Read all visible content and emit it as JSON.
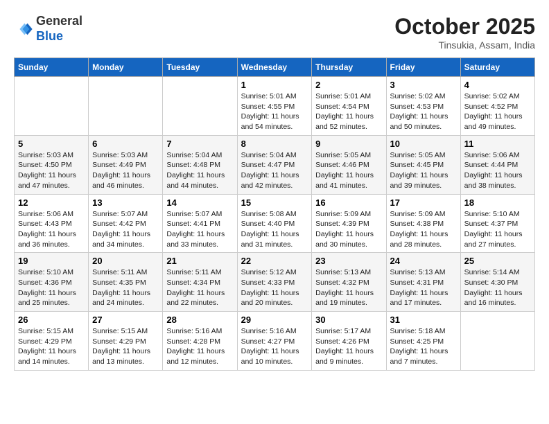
{
  "header": {
    "logo": {
      "line1": "General",
      "line2": "Blue"
    },
    "month": "October 2025",
    "location": "Tinsukia, Assam, India"
  },
  "weekdays": [
    "Sunday",
    "Monday",
    "Tuesday",
    "Wednesday",
    "Thursday",
    "Friday",
    "Saturday"
  ],
  "weeks": [
    [
      {
        "day": "",
        "sunrise": "",
        "sunset": "",
        "daylight": ""
      },
      {
        "day": "",
        "sunrise": "",
        "sunset": "",
        "daylight": ""
      },
      {
        "day": "",
        "sunrise": "",
        "sunset": "",
        "daylight": ""
      },
      {
        "day": "1",
        "sunrise": "Sunrise: 5:01 AM",
        "sunset": "Sunset: 4:55 PM",
        "daylight": "Daylight: 11 hours and 54 minutes."
      },
      {
        "day": "2",
        "sunrise": "Sunrise: 5:01 AM",
        "sunset": "Sunset: 4:54 PM",
        "daylight": "Daylight: 11 hours and 52 minutes."
      },
      {
        "day": "3",
        "sunrise": "Sunrise: 5:02 AM",
        "sunset": "Sunset: 4:53 PM",
        "daylight": "Daylight: 11 hours and 50 minutes."
      },
      {
        "day": "4",
        "sunrise": "Sunrise: 5:02 AM",
        "sunset": "Sunset: 4:52 PM",
        "daylight": "Daylight: 11 hours and 49 minutes."
      }
    ],
    [
      {
        "day": "5",
        "sunrise": "Sunrise: 5:03 AM",
        "sunset": "Sunset: 4:50 PM",
        "daylight": "Daylight: 11 hours and 47 minutes."
      },
      {
        "day": "6",
        "sunrise": "Sunrise: 5:03 AM",
        "sunset": "Sunset: 4:49 PM",
        "daylight": "Daylight: 11 hours and 46 minutes."
      },
      {
        "day": "7",
        "sunrise": "Sunrise: 5:04 AM",
        "sunset": "Sunset: 4:48 PM",
        "daylight": "Daylight: 11 hours and 44 minutes."
      },
      {
        "day": "8",
        "sunrise": "Sunrise: 5:04 AM",
        "sunset": "Sunset: 4:47 PM",
        "daylight": "Daylight: 11 hours and 42 minutes."
      },
      {
        "day": "9",
        "sunrise": "Sunrise: 5:05 AM",
        "sunset": "Sunset: 4:46 PM",
        "daylight": "Daylight: 11 hours and 41 minutes."
      },
      {
        "day": "10",
        "sunrise": "Sunrise: 5:05 AM",
        "sunset": "Sunset: 4:45 PM",
        "daylight": "Daylight: 11 hours and 39 minutes."
      },
      {
        "day": "11",
        "sunrise": "Sunrise: 5:06 AM",
        "sunset": "Sunset: 4:44 PM",
        "daylight": "Daylight: 11 hours and 38 minutes."
      }
    ],
    [
      {
        "day": "12",
        "sunrise": "Sunrise: 5:06 AM",
        "sunset": "Sunset: 4:43 PM",
        "daylight": "Daylight: 11 hours and 36 minutes."
      },
      {
        "day": "13",
        "sunrise": "Sunrise: 5:07 AM",
        "sunset": "Sunset: 4:42 PM",
        "daylight": "Daylight: 11 hours and 34 minutes."
      },
      {
        "day": "14",
        "sunrise": "Sunrise: 5:07 AM",
        "sunset": "Sunset: 4:41 PM",
        "daylight": "Daylight: 11 hours and 33 minutes."
      },
      {
        "day": "15",
        "sunrise": "Sunrise: 5:08 AM",
        "sunset": "Sunset: 4:40 PM",
        "daylight": "Daylight: 11 hours and 31 minutes."
      },
      {
        "day": "16",
        "sunrise": "Sunrise: 5:09 AM",
        "sunset": "Sunset: 4:39 PM",
        "daylight": "Daylight: 11 hours and 30 minutes."
      },
      {
        "day": "17",
        "sunrise": "Sunrise: 5:09 AM",
        "sunset": "Sunset: 4:38 PM",
        "daylight": "Daylight: 11 hours and 28 minutes."
      },
      {
        "day": "18",
        "sunrise": "Sunrise: 5:10 AM",
        "sunset": "Sunset: 4:37 PM",
        "daylight": "Daylight: 11 hours and 27 minutes."
      }
    ],
    [
      {
        "day": "19",
        "sunrise": "Sunrise: 5:10 AM",
        "sunset": "Sunset: 4:36 PM",
        "daylight": "Daylight: 11 hours and 25 minutes."
      },
      {
        "day": "20",
        "sunrise": "Sunrise: 5:11 AM",
        "sunset": "Sunset: 4:35 PM",
        "daylight": "Daylight: 11 hours and 24 minutes."
      },
      {
        "day": "21",
        "sunrise": "Sunrise: 5:11 AM",
        "sunset": "Sunset: 4:34 PM",
        "daylight": "Daylight: 11 hours and 22 minutes."
      },
      {
        "day": "22",
        "sunrise": "Sunrise: 5:12 AM",
        "sunset": "Sunset: 4:33 PM",
        "daylight": "Daylight: 11 hours and 20 minutes."
      },
      {
        "day": "23",
        "sunrise": "Sunrise: 5:13 AM",
        "sunset": "Sunset: 4:32 PM",
        "daylight": "Daylight: 11 hours and 19 minutes."
      },
      {
        "day": "24",
        "sunrise": "Sunrise: 5:13 AM",
        "sunset": "Sunset: 4:31 PM",
        "daylight": "Daylight: 11 hours and 17 minutes."
      },
      {
        "day": "25",
        "sunrise": "Sunrise: 5:14 AM",
        "sunset": "Sunset: 4:30 PM",
        "daylight": "Daylight: 11 hours and 16 minutes."
      }
    ],
    [
      {
        "day": "26",
        "sunrise": "Sunrise: 5:15 AM",
        "sunset": "Sunset: 4:29 PM",
        "daylight": "Daylight: 11 hours and 14 minutes."
      },
      {
        "day": "27",
        "sunrise": "Sunrise: 5:15 AM",
        "sunset": "Sunset: 4:29 PM",
        "daylight": "Daylight: 11 hours and 13 minutes."
      },
      {
        "day": "28",
        "sunrise": "Sunrise: 5:16 AM",
        "sunset": "Sunset: 4:28 PM",
        "daylight": "Daylight: 11 hours and 12 minutes."
      },
      {
        "day": "29",
        "sunrise": "Sunrise: 5:16 AM",
        "sunset": "Sunset: 4:27 PM",
        "daylight": "Daylight: 11 hours and 10 minutes."
      },
      {
        "day": "30",
        "sunrise": "Sunrise: 5:17 AM",
        "sunset": "Sunset: 4:26 PM",
        "daylight": "Daylight: 11 hours and 9 minutes."
      },
      {
        "day": "31",
        "sunrise": "Sunrise: 5:18 AM",
        "sunset": "Sunset: 4:25 PM",
        "daylight": "Daylight: 11 hours and 7 minutes."
      },
      {
        "day": "",
        "sunrise": "",
        "sunset": "",
        "daylight": ""
      }
    ]
  ]
}
